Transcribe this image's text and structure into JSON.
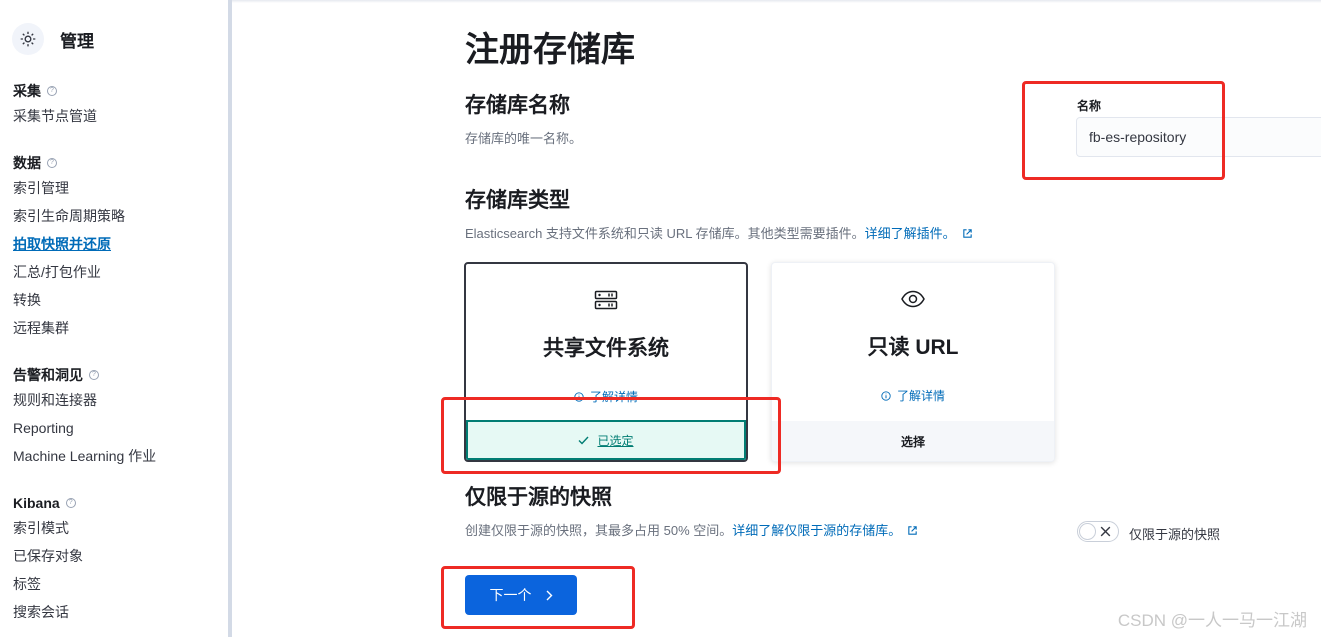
{
  "sidebar": {
    "title": "管理",
    "groups": [
      {
        "title": "采集",
        "items": [
          "采集节点管道"
        ]
      },
      {
        "title": "数据",
        "items": [
          "索引管理",
          "索引生命周期策略",
          "拍取快照并还原",
          "汇总/打包作业",
          "转换",
          "远程集群"
        ]
      },
      {
        "title": "告警和洞见",
        "items": [
          "规则和连接器",
          "Reporting",
          "Machine Learning 作业"
        ]
      },
      {
        "title": "Kibana",
        "items": [
          "索引模式",
          "已保存对象",
          "标签",
          "搜索会话"
        ]
      }
    ],
    "active_item": "拍取快照并还原"
  },
  "main": {
    "page_title": "注册存储库",
    "name_section": {
      "title": "存储库名称",
      "desc": "存储库的唯一名称。",
      "field_label": "名称",
      "field_value": "fb-es-repository"
    },
    "type_section": {
      "title": "存储库类型",
      "desc": "Elasticsearch 支持文件系统和只读 URL 存储库。其他类型需要插件。",
      "link": "详细了解插件。",
      "cards": [
        {
          "title": "共享文件系统",
          "more": "了解详情",
          "footer": "已选定",
          "selected": true
        },
        {
          "title": "只读 URL",
          "more": "了解详情",
          "footer": "选择",
          "selected": false
        }
      ]
    },
    "source_only_section": {
      "title": "仅限于源的快照",
      "desc": "创建仅限于源的快照，其最多占用 50% 空间。",
      "link": "详细了解仅限于源的存储库。",
      "toggle_label": "仅限于源的快照",
      "toggle_on": false
    },
    "next_button": "下一个"
  },
  "watermark": "CSDN @一人一马一江湖",
  "colors": {
    "accent": "#006bb8",
    "primary_button": "#0b64dd",
    "selected_green": "#017d73",
    "annotation_red": "#ee2a24"
  }
}
